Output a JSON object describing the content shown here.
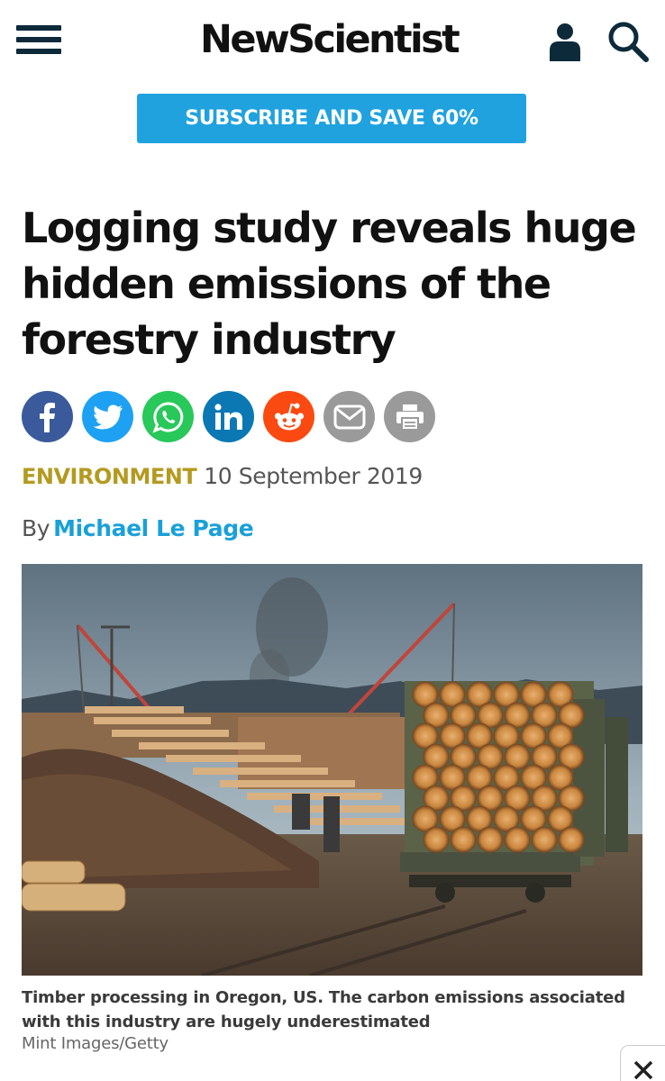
{
  "header": {
    "logo": "NewScientist",
    "menu_icon": "hamburger-menu-icon",
    "account_icon": "account-icon",
    "search_icon": "search-icon",
    "brand_dark": "#0c2a3a"
  },
  "subscribe": {
    "label": "SUBSCRIBE AND SAVE 60%",
    "color": "#20a2df"
  },
  "article": {
    "title": "Logging study reveals huge hidden emissions of the forestry industry",
    "category": "ENVIRONMENT",
    "category_color": "#b49a20",
    "date": "10 September 2019",
    "byline_prefix": "By",
    "author": "Michael Le Page",
    "author_color": "#1aa0d8"
  },
  "share": [
    {
      "name": "facebook",
      "icon": "facebook-icon",
      "color": "#3a5a9b"
    },
    {
      "name": "twitter",
      "icon": "twitter-icon",
      "color": "#1ea1f2"
    },
    {
      "name": "whatsapp",
      "icon": "whatsapp-icon",
      "color": "#28c85a"
    },
    {
      "name": "linkedin",
      "icon": "linkedin-icon",
      "color": "#0b78b4"
    },
    {
      "name": "reddit",
      "icon": "reddit-icon",
      "color": "#fa4a12"
    },
    {
      "name": "email",
      "icon": "email-icon",
      "color": "#9a9a9a"
    },
    {
      "name": "print",
      "icon": "print-icon",
      "color": "#9a9a9a"
    }
  ],
  "image": {
    "caption": "Timber processing in Oregon, US. The carbon emissions associated with this industry are hugely underestimated",
    "credit": "Mint Images/Getty"
  },
  "close": {
    "icon": "close-icon"
  }
}
